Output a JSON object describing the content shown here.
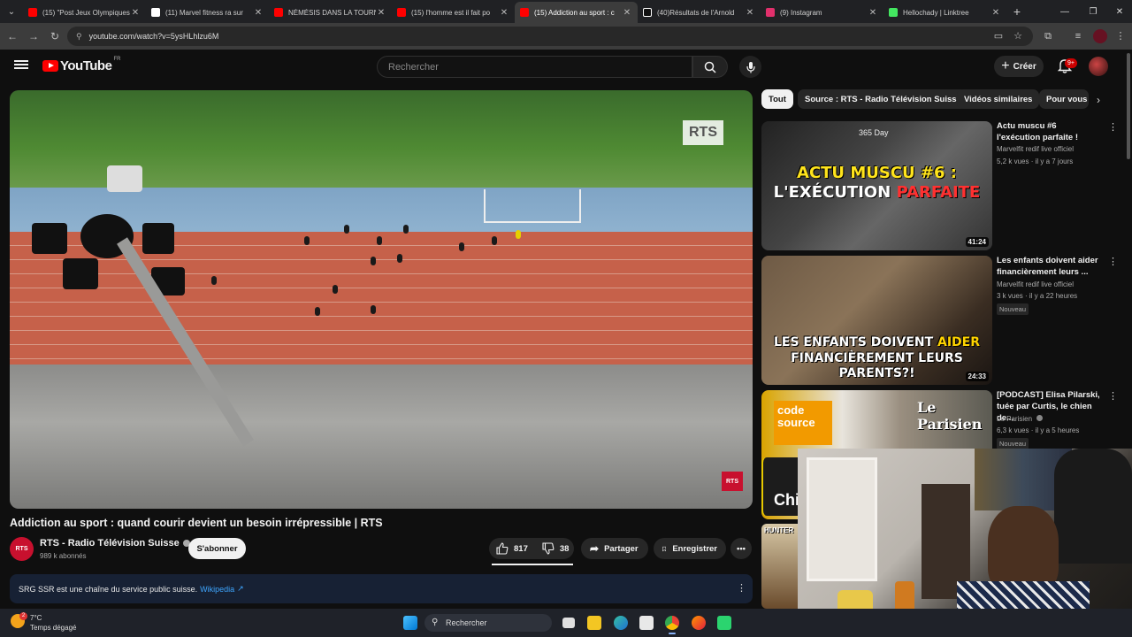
{
  "browser": {
    "tabs": [
      {
        "title": "(15) \"Post Jeux Olympiques",
        "color": "#ff0000"
      },
      {
        "title": "(11) Marvel fitness ra sur",
        "color": "#ffffff"
      },
      {
        "title": "NÉMÉSIS DANS LA TOURNÉE",
        "color": "#ff0000"
      },
      {
        "title": "(15) l'homme est il fait po",
        "color": "#ff0000"
      },
      {
        "title": "(15) Addiction au sport : c",
        "color": "#ff0000",
        "active": true
      },
      {
        "title": "(40)Résultats de l'Arnold",
        "color": "#ffffff"
      },
      {
        "title": "(9) Instagram",
        "color": "#e1306c"
      },
      {
        "title": "Hellochady | Linktree",
        "color": "#43e660"
      }
    ],
    "url": "youtube.com/watch?v=5ysHLhlzu6M"
  },
  "header": {
    "logo_text": "YouTube",
    "logo_country": "FR",
    "search_placeholder": "Rechercher",
    "create_label": "Créer",
    "notif_badge": "9+"
  },
  "video": {
    "title": "Addiction au sport : quand courir devient un besoin irrépressible | RTS",
    "watermark": "RTS",
    "corner_logo": "RTS",
    "channel": {
      "avatar_text": "RTS",
      "name": "RTS - Radio Télévision Suisse",
      "subscribers": "989 k abonnés",
      "subscribe_label": "S'abonner"
    },
    "likes": "817",
    "dislikes": "38",
    "share_label": "Partager",
    "save_label": "Enregistrer",
    "description": "SRG SSR est une chaîne du service public suisse.",
    "description_link": "Wikipedia"
  },
  "sidebar": {
    "chips": [
      "Tout",
      "Source : RTS - Radio Télévision Suisse",
      "Vidéos similaires",
      "Pour vous"
    ],
    "videos": [
      {
        "title": "Actu muscu #6 l'exécution parfaite !",
        "channel": "Marvelfit redif live officiel",
        "meta": "5,2 k vues · il y a 7 jours",
        "duration": "41:24",
        "thumb_text_1": "ACTU MUSCU #6 :",
        "thumb_text_2": "L'EXÉCUTION",
        "thumb_text_3": "PARFAITE",
        "thumb_tag": "365 Day"
      },
      {
        "title": "Les enfants doivent aider financièrement leurs ...",
        "channel": "Marvelfit redif live officiel",
        "meta": "3 k vues · il y a 22 heures",
        "badge": "Nouveau",
        "duration": "24:33",
        "thumb_text_1": "LES ENFANTS DOIVENT",
        "thumb_text_2": "AIDER",
        "thumb_text_3": "FINANCIÈREMENT LEURS",
        "thumb_text_4": "PARENTS?!"
      },
      {
        "title": "[PODCAST] Elisa Pilarski, tuée par Curtis, le chien de...",
        "channel": "Le Parisien",
        "meta": "6,3 k vues · il y a 5 heures",
        "badge": "Nouveau",
        "thumb_text_1": "code",
        "thumb_text_2": "source",
        "thumb_text_3": "Le Parisien"
      }
    ],
    "partial_thumb_1": "Chi",
    "partial_thumb_2": "HUNTER"
  },
  "taskbar": {
    "weather_temp": "7°C",
    "weather_desc": "Temps dégagé",
    "weather_badge": "2",
    "search_label": "Rechercher"
  }
}
